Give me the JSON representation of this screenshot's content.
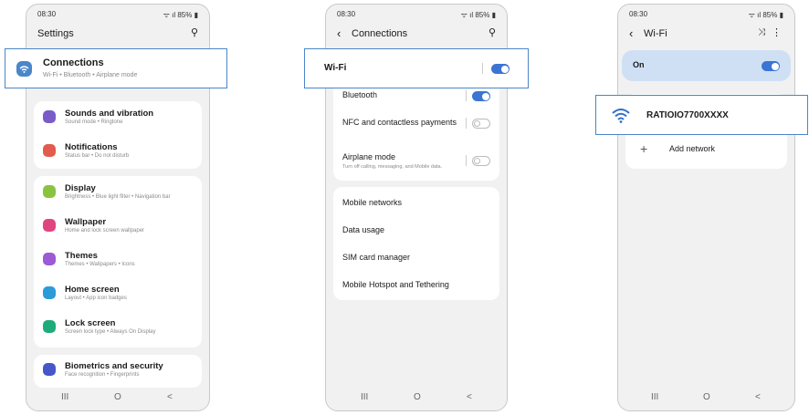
{
  "colors": {
    "accent": "#3b74d4",
    "highlight_border": "#4a86c8",
    "wifi_on_bar": "#cfe0f5"
  },
  "status": {
    "time": "08:30",
    "battery": "85%",
    "signal_glyphs": "ᯤ ıl"
  },
  "nav": {
    "recents": "III",
    "home": "O",
    "back": "<"
  },
  "screen1": {
    "title": "Settings",
    "connections": {
      "label": "Connections",
      "sub": "Wi-Fi  •  Bluetooth  •  Airplane mode"
    },
    "items": [
      {
        "label": "Sounds and vibration",
        "sub": "Sound mode  •  Ringtone",
        "icon": "speaker-icon",
        "color": "#7a5cc8"
      },
      {
        "label": "Notifications",
        "sub": "Status bar  •  Do not disturb",
        "icon": "bell-icon",
        "color": "#e25b4f"
      },
      {
        "label": "Display",
        "sub": "Brightness  •  Blue light filter  •  Navigation bar",
        "icon": "sun-icon",
        "color": "#8ac43f"
      },
      {
        "label": "Wallpaper",
        "sub": "Home and lock screen wallpaper",
        "icon": "image-icon",
        "color": "#e0457f"
      },
      {
        "label": "Themes",
        "sub": "Themes  •  Wallpapers  •  Icons",
        "icon": "palette-icon",
        "color": "#9c5ad4"
      },
      {
        "label": "Home screen",
        "sub": "Layout  •  App icon badges",
        "icon": "home-icon",
        "color": "#2c9bd8"
      },
      {
        "label": "Lock screen",
        "sub": "Screen lock type  •  Always On Display",
        "icon": "lock-icon",
        "color": "#1faa7a"
      },
      {
        "label": "Biometrics and security",
        "sub": "Face recognition  •  Fingerprints",
        "icon": "shield-icon",
        "color": "#4657c8"
      }
    ]
  },
  "screen2": {
    "title": "Connections",
    "wifi_label": "Wi-Fi",
    "bluetooth": "Bluetooth",
    "nfc": "NFC and contactless payments",
    "airplane": {
      "label": "Airplane mode",
      "sub": "Turn off calling, messaging, and Mobile data."
    },
    "links": [
      "Mobile networks",
      "Data usage",
      "SIM card manager",
      "Mobile Hotspot and Tethering"
    ]
  },
  "screen3": {
    "title": "Wi-Fi",
    "on_label": "On",
    "network": "RATIOIO7700XXXX",
    "add": "Add network",
    "add_icon_glyph": "+"
  }
}
